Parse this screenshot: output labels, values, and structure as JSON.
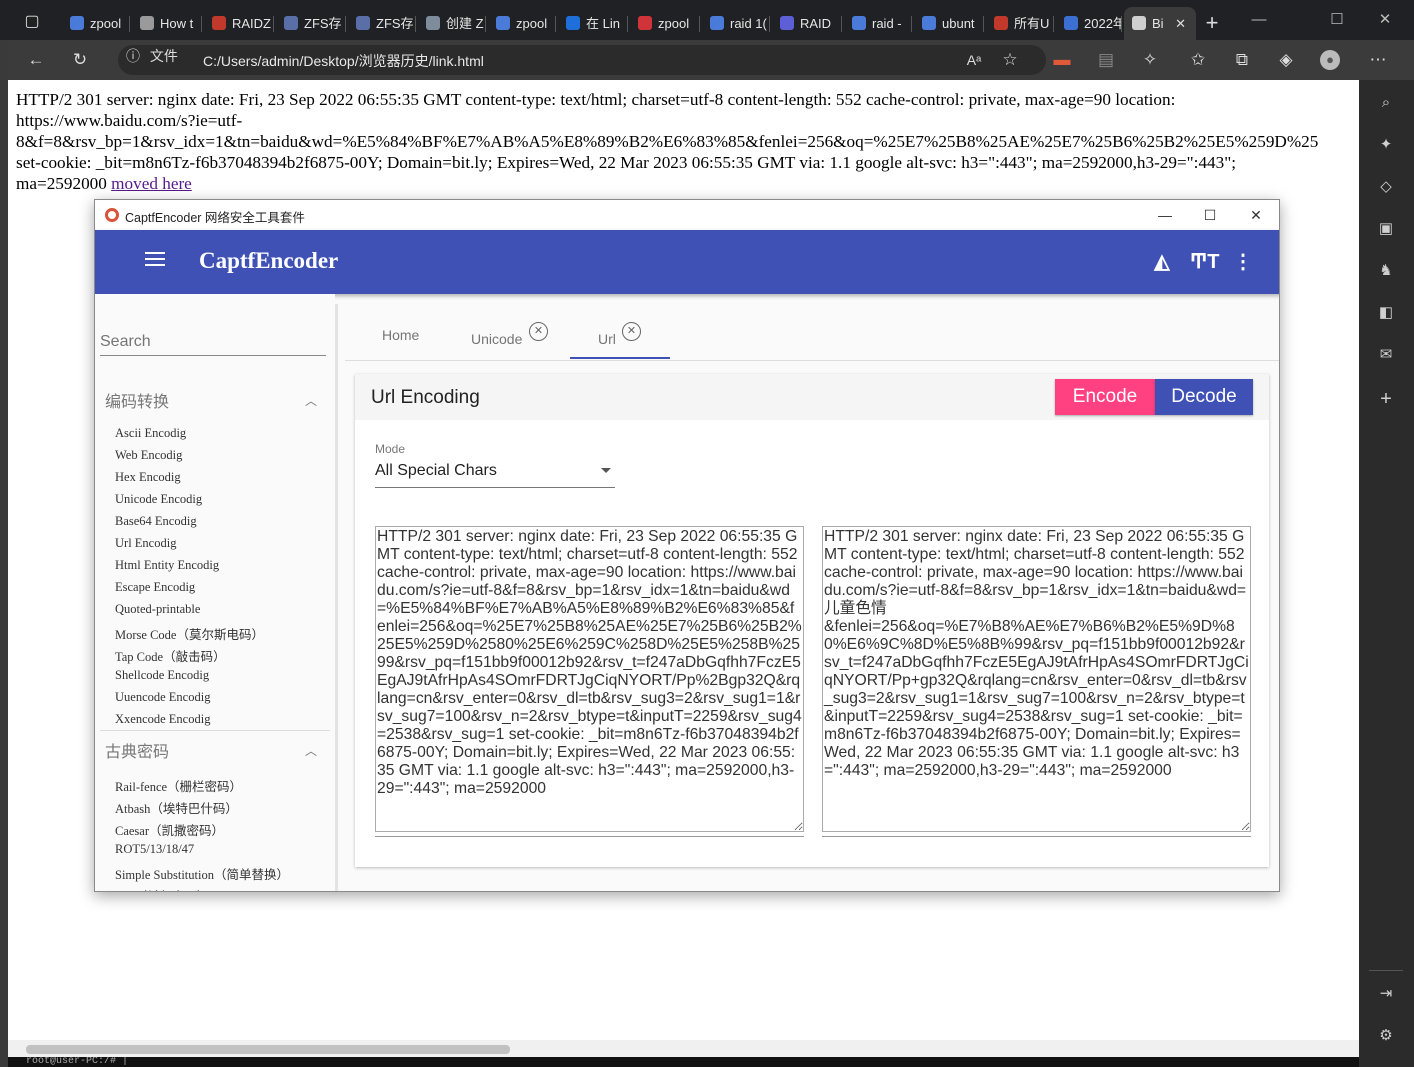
{
  "browser": {
    "tabs": [
      {
        "label": "zpool",
        "color": "#4b7bd8"
      },
      {
        "label": "How t",
        "color": "#9a9a9a"
      },
      {
        "label": "RAIDZ",
        "color": "#c0392b"
      },
      {
        "label": "ZFS存",
        "color": "#5a6fa8"
      },
      {
        "label": "ZFS存",
        "color": "#5a6fa8"
      },
      {
        "label": "创建 Z",
        "color": "#7f8c9c"
      },
      {
        "label": "zpool",
        "color": "#4b7bd8"
      },
      {
        "label": "在 Lin",
        "color": "#1e6fd9"
      },
      {
        "label": "zpool",
        "color": "#d13438"
      },
      {
        "label": "raid 1(",
        "color": "#4b7bd8"
      },
      {
        "label": "RAID ",
        "color": "#5c5fd6"
      },
      {
        "label": "raid -",
        "color": "#4b7bd8"
      },
      {
        "label": "ubunt",
        "color": "#4b7bd8"
      },
      {
        "label": "所有U",
        "color": "#c0392b"
      },
      {
        "label": "2022年",
        "color": "#3b6fd1"
      },
      {
        "label": "Bi",
        "color": "#d0d0d0"
      }
    ],
    "file_label": "文件",
    "url": "C:/Users/admin/Desktop/浏览器历史/link.html"
  },
  "page": {
    "line1": "HTTP/2 301 server: nginx date: Fri, 23 Sep 2022 06:55:35 GMT content-type: text/html; charset=utf-8 content-length: 552 cache-control: private, max-age=90 location:",
    "line2": "https://www.baidu.com/s?ie=utf-",
    "line3": "8&f=8&rsv_bp=1&rsv_idx=1&tn=baidu&wd=%E5%84%BF%E7%AB%A5%E8%89%B2%E6%83%85&fenlei=256&oq=%25E7%25B8%25AE%25E7%25B6%25B2%25E5%259D%25",
    "line4": "set-cookie: _bit=m8n6Tz-f6b37048394b2f6875-00Y; Domain=bit.ly; Expires=Wed, 22 Mar 2023 06:55:35 GMT via: 1.1 google alt-svc: h3=\":443\"; ma=2592000,h3-29=\":443\";",
    "line5_prefix": "ma=2592000 ",
    "link_text": "moved here"
  },
  "terminal": {
    "text": "root@user-PC:/# |"
  },
  "app": {
    "window_title": "CaptfEncoder 网络安全工具套件",
    "name": "CaptfEncoder",
    "search_placeholder": "Search",
    "groups": [
      {
        "title": "编码转换",
        "items": [
          "Ascii Encodig",
          "Web Encodig",
          "Hex Encodig",
          "Unicode Encodig",
          "Base64 Encodig",
          "Url Encodig",
          "Html Entity Encodig",
          "Escape Encodig",
          "Quoted-printable",
          "Morse Code（莫尔斯电码）",
          "Tap Code（敲击码）",
          "Shellcode Encodig",
          "Uuencode Encodig",
          "Xxencode Encodig"
        ]
      },
      {
        "title": "古典密码",
        "items": [
          "Rail-fence（栅栏密码）",
          "Atbash（埃特巴什码）",
          "Caesar（凯撒密码）",
          "ROT5/13/18/47",
          "Simple Substitution（简单替换）",
          "Hill（希尔密码）"
        ]
      }
    ],
    "tabs": {
      "home": "Home",
      "unicode": "Unicode",
      "url": "Url"
    },
    "card": {
      "title": "Url Encoding",
      "encode": "Encode",
      "decode": "Decode",
      "mode_label": "Mode",
      "mode_value": "All Special Chars",
      "input": "HTTP/2 301 server: nginx date: Fri, 23 Sep 2022 06:55:35 GMT content-type: text/html; charset=utf-8 content-length: 552 cache-control: private, max-age=90 location: https://www.baidu.com/s?ie=utf-8&f=8&rsv_bp=1&rsv_idx=1&tn=baidu&wd=%E5%84%BF%E7%AB%A5%E8%89%B2%E6%83%85&fenlei=256&oq=%25E7%25B8%25AE%25E7%25B6%25B2%25E5%259D%2580%25E6%259C%258D%25E5%258B%2599&rsv_pq=f151bb9f00012b92&rsv_t=f247aDbGqfhh7FczE5EgAJ9tAfrHpAs4SOmrFDRTJgCiqNYORT/Pp%2Bgp32Q&rqlang=cn&rsv_enter=0&rsv_dl=tb&rsv_sug3=2&rsv_sug1=1&rsv_sug7=100&rsv_n=2&rsv_btype=t&inputT=2259&rsv_sug4=2538&rsv_sug=1 set-cookie: _bit=m8n6Tz-f6b37048394b2f6875-00Y; Domain=bit.ly; Expires=Wed, 22 Mar 2023 06:55:35 GMT via: 1.1 google alt-svc: h3=\":443\"; ma=2592000,h3-29=\":443\"; ma=2592000",
      "output": "HTTP/2 301 server: nginx date: Fri, 23 Sep 2022 06:55:35 GMT content-type: text/html; charset=utf-8 content-length: 552 cache-control: private, max-age=90 location: https://www.baidu.com/s?ie=utf-8&f=8&rsv_bp=1&rsv_idx=1&tn=baidu&wd=儿童色情\n&fenlei=256&oq=%E7%B8%AE%E7%B6%B2%E5%9D%80%E6%9C%8D%E5%8B%99&rsv_pq=f151bb9f00012b92&rsv_t=f247aDbGqfhh7FczE5EgAJ9tAfrHpAs4SOmrFDRTJgCiqNYORT/Pp+gp32Q&rqlang=cn&rsv_enter=0&rsv_dl=tb&rsv_sug3=2&rsv_sug1=1&rsv_sug7=100&rsv_n=2&rsv_btype=t&inputT=2259&rsv_sug4=2538&rsv_sug=1 set-cookie: _bit=m8n6Tz-f6b37048394b2f6875-00Y; Domain=bit.ly; Expires=Wed, 22 Mar 2023 06:55:35 GMT via: 1.1 google alt-svc: h3=\":443\"; ma=2592000,h3-29=\":443\"; ma=2592000"
    }
  },
  "colors": {
    "primary": "#3f51b5",
    "accent": "#ff4081"
  },
  "icons": {
    "toolbar": [
      "back-icon",
      "refresh-icon",
      "info-icon",
      "read-aloud-icon",
      "add-favorite-icon",
      "collections-red-icon",
      "tab-actions-icon",
      "extensions-icon",
      "favorites-icon",
      "collections-icon",
      "browser-essentials-icon",
      "profile-icon",
      "more-icon"
    ],
    "sidebar": [
      "search-icon",
      "sparkle-icon",
      "tag-icon",
      "briefcase-icon",
      "games-icon",
      "office-icon",
      "outlook-icon",
      "add-icon",
      "collapse-icon",
      "settings-icon"
    ],
    "appbar": [
      "paint-bucket-icon",
      "text-size-icon",
      "more-vert-icon"
    ]
  }
}
